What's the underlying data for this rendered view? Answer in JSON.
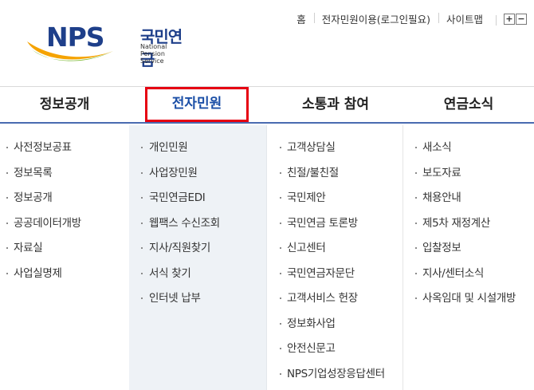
{
  "header": {
    "logo_text": "NPS",
    "logo_ko": "국민연금",
    "logo_en": "National Pension Service",
    "util_links": [
      "홈",
      "전자민원이용(로그인필요)",
      "사이트맵"
    ],
    "zoom_in": "+",
    "zoom_out": "−"
  },
  "gnb": {
    "menus": [
      {
        "label": "정보공개"
      },
      {
        "label": "전자민원"
      },
      {
        "label": "소통과 참여"
      },
      {
        "label": "연금소식"
      }
    ],
    "highlight_color": "#e60012",
    "active_text_color": "#1a4ea6"
  },
  "submenus": [
    {
      "items": [
        "사전정보공표",
        "정보목록",
        "정보공개",
        "공공데이터개방",
        "자료실",
        "사업실명제"
      ]
    },
    {
      "items": [
        "개인민원",
        "사업장민원",
        "국민연금EDI",
        "웹팩스 수신조회",
        "지사/직원찾기",
        "서식 찾기",
        "인터넷 납부"
      ]
    },
    {
      "items": [
        "고객상담실",
        "친절/불친절",
        "국민제안",
        "국민연금 토론방",
        "신고센터",
        "국민연금자문단",
        "고객서비스 헌장",
        "정보화사업",
        "안전신문고",
        "NPS기업성장응답센터"
      ]
    },
    {
      "items": [
        "새소식",
        "보도자료",
        "채용안내",
        "제5차 재정계산",
        "입찰정보",
        "지사/센터소식",
        "사옥임대 및 시설개방"
      ]
    }
  ]
}
